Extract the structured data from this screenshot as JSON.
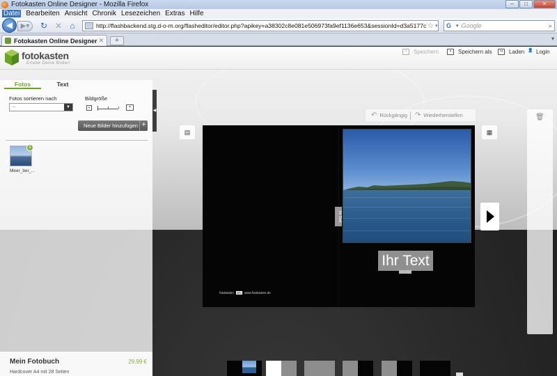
{
  "browser": {
    "window_title": "Fotokasten Online Designer - Mozilla Firefox",
    "menu": [
      "Datei",
      "Bearbeiten",
      "Ansicht",
      "Chronik",
      "Lesezeichen",
      "Extras",
      "Hilfe"
    ],
    "url": "http://flashbackend.stg.d-o-m.org/flasheditor/editor.php?apikey=a38302c8e081e506973fa9ef1136e653&sessionId=d3a5177c45221718935de758",
    "search_placeholder": "Google",
    "tab_title": "Fotokasten Online Designer"
  },
  "app": {
    "logo_text": "fotokasten",
    "logo_tagline": "Erlebe Deine Bilder!",
    "header_buttons": {
      "save": "Speichern",
      "save_as": "Speichern als",
      "load": "Laden",
      "login": "Login"
    },
    "left_panel": {
      "tab_photos": "Fotos",
      "tab_text": "Text",
      "sort_label": "Fotos sortieren nach",
      "sort_value": "...",
      "size_label": "Bildgröße",
      "add_images": "Neue Bilder hinzufügen",
      "photo_name": "Meer_bei_...",
      "photo_badge": "1"
    },
    "toolbar": {
      "undo": "Rückgängig",
      "redo": "Wiederherstellen"
    },
    "book": {
      "text_placeholder": "Ihr Text",
      "photo_hint": "Ihr Text",
      "footer_brand": "fotokasten",
      "footer_brand_box": "info",
      "footer_url": "www.fotokasten.de"
    },
    "product": {
      "name": "Mein Fotobuch",
      "price": "29,99 €",
      "desc": "Hardcover A4 mit 28 Seiten"
    }
  }
}
